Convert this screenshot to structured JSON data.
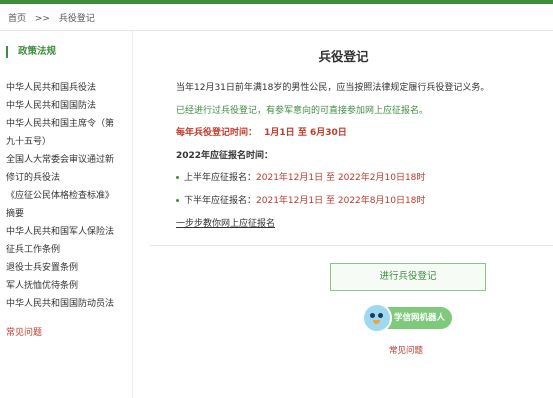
{
  "breadcrumb": {
    "home": "首页",
    "sep": ">>",
    "current": "兵役登记"
  },
  "sidebar": {
    "heading": "政策法规",
    "items": [
      "中华人民共和国兵役法",
      "中华人民共和国国防法",
      "中华人民共和国主席令（第",
      "九十五号）",
      "全国人大常委会审议通过新",
      "修订的兵役法",
      "《应征公民体格检查标准》",
      "摘要",
      "中华人民共和国军人保险法",
      "征兵工作条例",
      "退役士兵安置条例",
      "军人抚恤优待条例",
      "中华人民共和国国防动员法"
    ],
    "faq": "常见问题"
  },
  "main": {
    "title": "兵役登记",
    "intro": "当年12月31日前年满18岁的男性公民，应当按照法律规定履行兵役登记义务。",
    "notice": "已经进行过兵役登记，有参军意向的可直接参加网上应征报名。",
    "period_label": "每年兵役登记时间：",
    "period_value": "1月1日 至 6月30日",
    "year_heading": "2022年应征报名时间：",
    "first_half_label": "上半年应征报名：",
    "first_half_start": "2021年12月1日",
    "first_half_to": "至",
    "first_half_end": "2022年2月10日18时",
    "second_half_label": "下半年应征报名：",
    "second_half_start": "2021年12月1日",
    "second_half_to": "至",
    "second_half_end": "2022年8月10日18时",
    "guide_link": "一步步教你网上应征报名",
    "register_button": "进行兵役登记",
    "robot_label": "学信网机器人",
    "faq": "常见问题"
  },
  "colors": {
    "accent": "#3e8e3e",
    "highlight": "#c0392b"
  }
}
